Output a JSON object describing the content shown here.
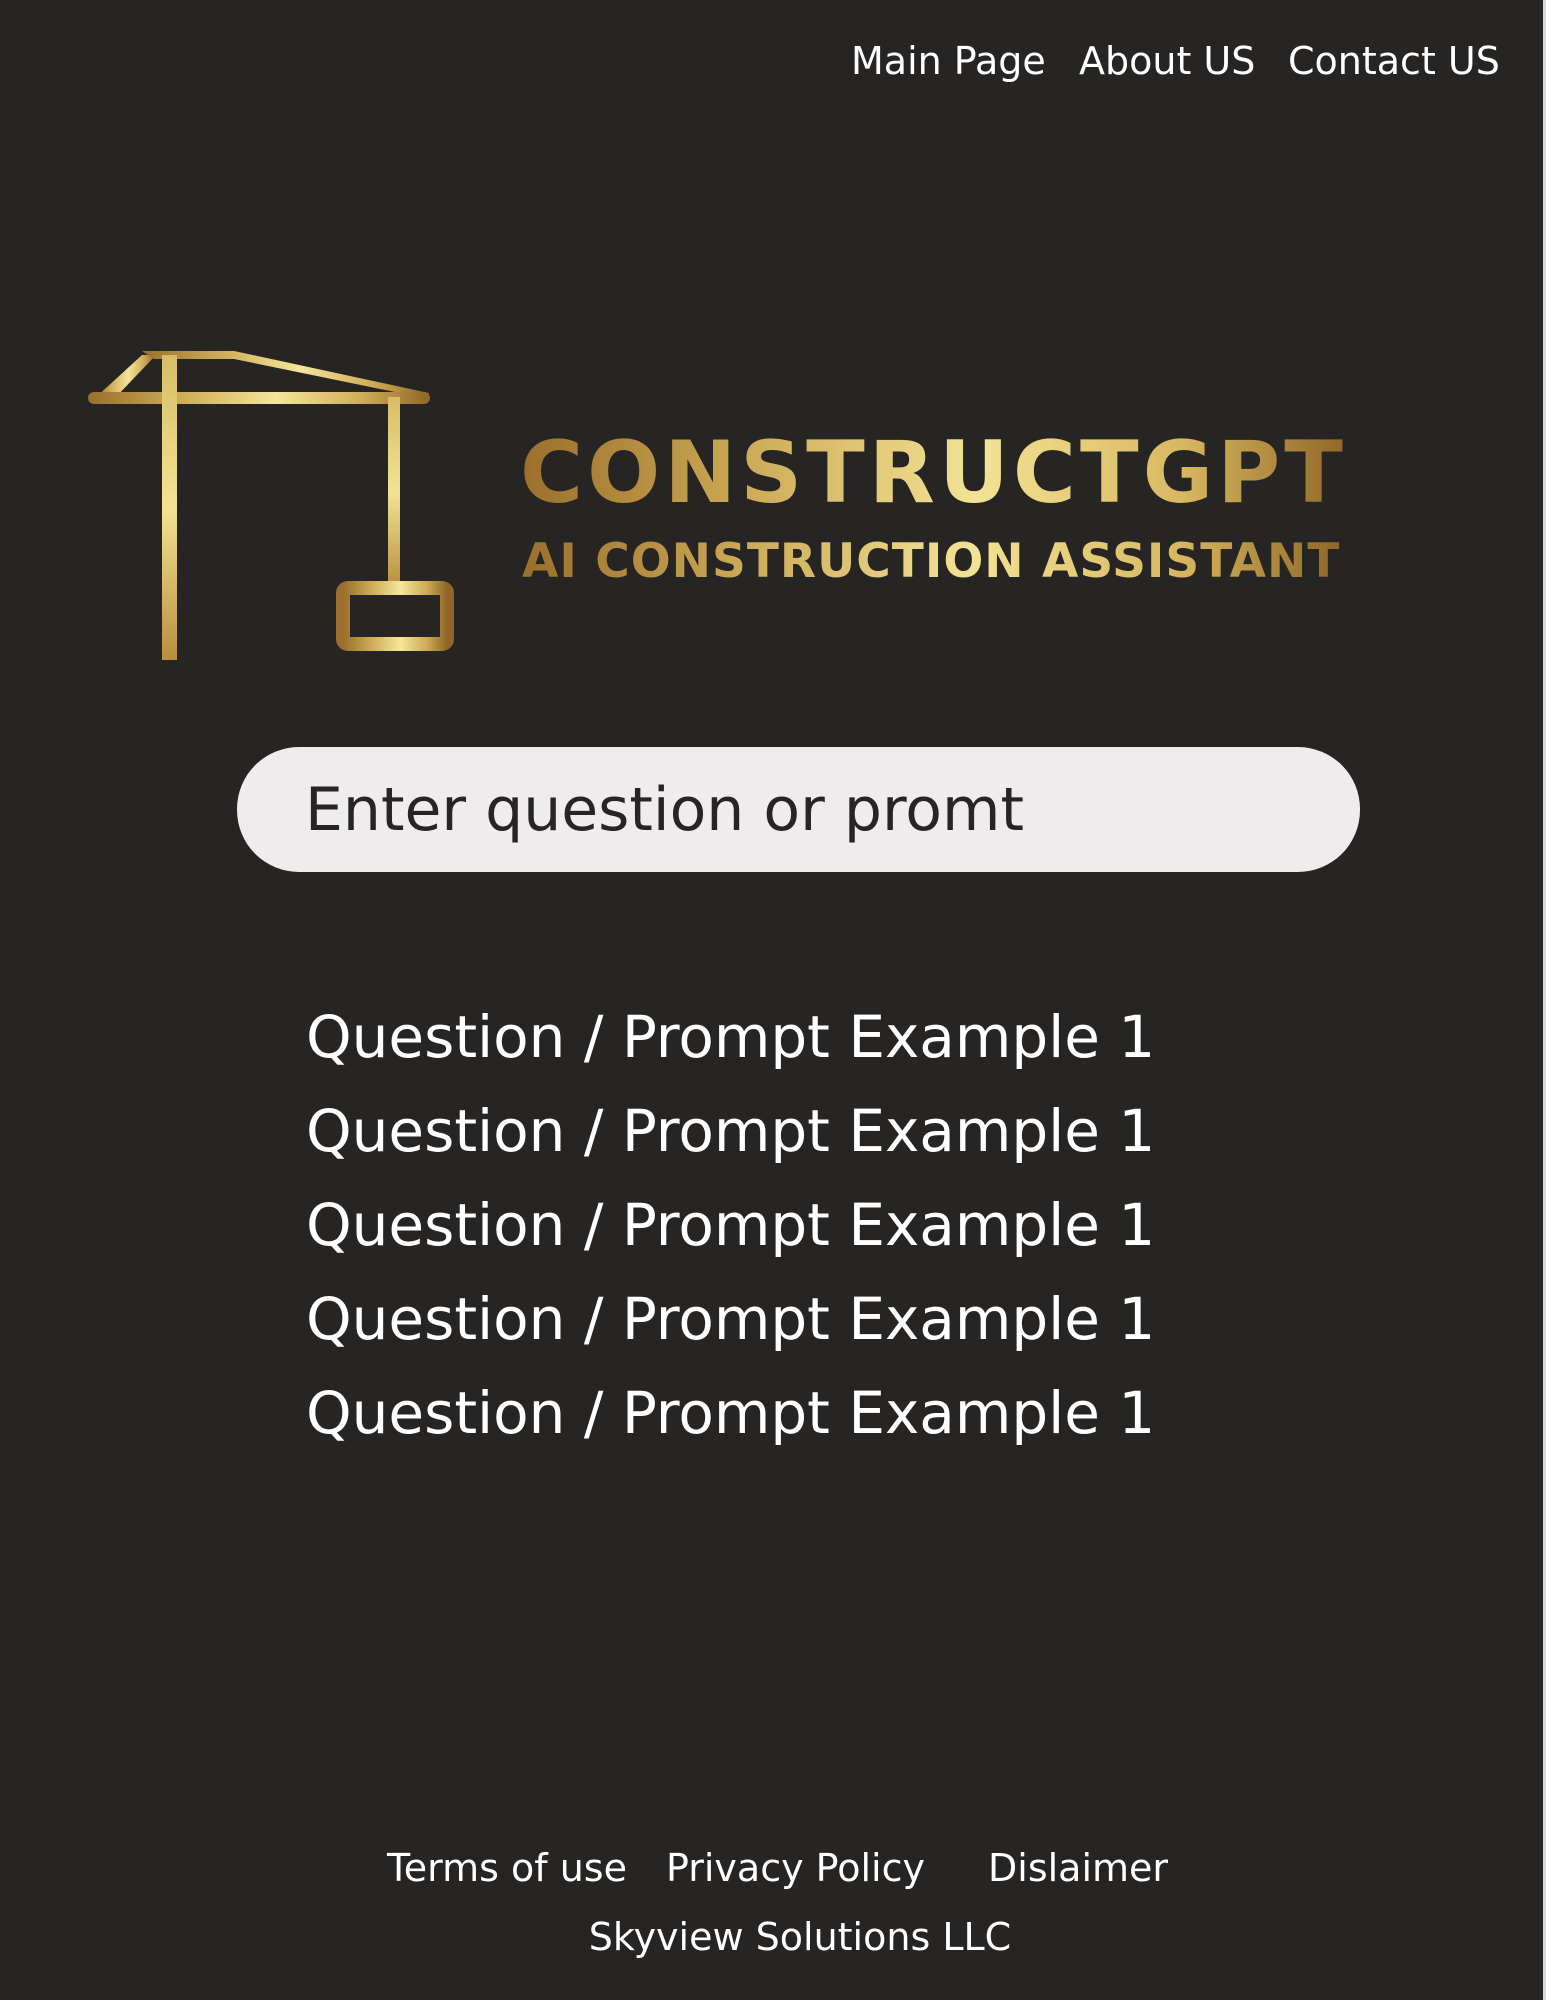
{
  "nav": {
    "items": [
      {
        "label": "Main Page"
      },
      {
        "label": "About US"
      },
      {
        "label": "Contact US"
      }
    ]
  },
  "brand": {
    "name": "CONSTRUCTGPT",
    "tagline": "AI CONSTRUCTION ASSISTANT",
    "logo_icon": "tower-crane-icon",
    "colors": {
      "gold_dark": "#9a6e2c",
      "gold_light": "#f2e394"
    }
  },
  "search": {
    "placeholder": "Enter question or promt",
    "value": ""
  },
  "examples": [
    "Question / Prompt Example 1",
    "Question / Prompt Example 1",
    "Question / Prompt Example 1",
    "Question / Prompt Example 1",
    "Question / Prompt Example 1"
  ],
  "footer": {
    "links": [
      {
        "label": "Terms of use"
      },
      {
        "label": "Privacy Policy"
      },
      {
        "label": "Dislaimer"
      }
    ],
    "company": "Skyview Solutions LLC"
  },
  "theme": {
    "background": "#262524",
    "text": "#ffffff",
    "search_bg": "#eeecec"
  }
}
